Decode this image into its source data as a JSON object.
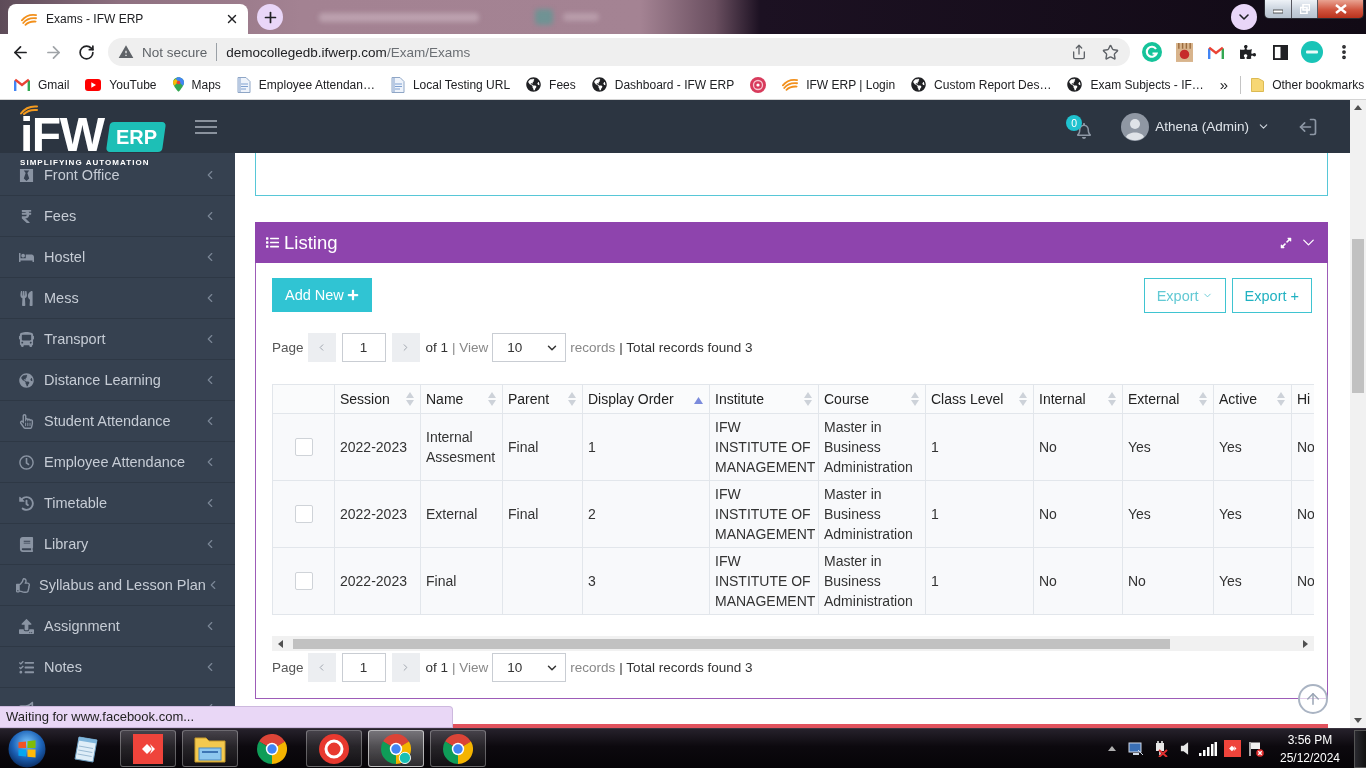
{
  "browser": {
    "tabs": [
      {
        "title": "Exams - IFW ERP",
        "selected": true
      }
    ],
    "address_bar": {
      "security": "Not secure",
      "host": "democollegedb.ifwerp.com",
      "path": "/Exam/Exams"
    },
    "bookmarks": [
      {
        "kind": "link",
        "label": "Gmail"
      },
      {
        "kind": "link",
        "label": "YouTube"
      },
      {
        "kind": "link",
        "label": "Maps"
      },
      {
        "kind": "link",
        "label": "Employee Attendan…"
      },
      {
        "kind": "link",
        "label": "Local Testing URL"
      },
      {
        "kind": "link",
        "label": "Fees"
      },
      {
        "kind": "link",
        "label": "Dashboard - IFW ERP"
      },
      {
        "kind": "icon"
      },
      {
        "kind": "link",
        "label": "IFW ERP | Login"
      },
      {
        "kind": "link",
        "label": "Custom Report Des…"
      },
      {
        "kind": "link",
        "label": "Exam Subjects - IF…"
      }
    ],
    "bookmarks_overflow": "»",
    "other_bookmarks": "Other bookmarks"
  },
  "app": {
    "logo": {
      "wordmark": "iFW",
      "badge": "ERP",
      "tagline": "SIMPLIFYING AUTOMATION"
    },
    "header": {
      "notification_count": "0",
      "user": "Athena (Admin)"
    },
    "sidebar": {
      "items": [
        {
          "label": "Front Office",
          "expanded": false
        },
        {
          "label": "Fees",
          "expanded": false
        },
        {
          "label": "Hostel",
          "expanded": false
        },
        {
          "label": "Mess",
          "expanded": false
        },
        {
          "label": "Transport",
          "expanded": false
        },
        {
          "label": "Distance Learning",
          "expanded": false
        },
        {
          "label": "Student Attendance",
          "expanded": false
        },
        {
          "label": "Employee Attendance",
          "expanded": false
        },
        {
          "label": "Timetable",
          "expanded": false
        },
        {
          "label": "Library",
          "expanded": false
        },
        {
          "label": "Syllabus and Lesson Plan",
          "expanded": false
        },
        {
          "label": "Assignment",
          "expanded": false
        },
        {
          "label": "Notes",
          "expanded": false
        },
        {
          "expanded": false
        }
      ]
    },
    "listing": {
      "title": "Listing",
      "add_button": "Add New",
      "export_buttons": [
        {
          "kind": "dropdown",
          "label": "Export"
        },
        {
          "kind": "plain",
          "label": "Export +"
        }
      ],
      "pagination": [
        {
          "label": "Page",
          "page": "1",
          "total_pages": "of 1",
          "view_label": "| View",
          "page_size": "10",
          "records_label": "records",
          "total": "| Total records found 3"
        },
        {
          "label": "Page",
          "page": "1",
          "total_pages": "of 1",
          "view_label": "| View",
          "page_size": "10",
          "records_label": "records",
          "total": "| Total records found 3"
        }
      ],
      "table": {
        "columns": [
          {
            "label": "Session",
            "sorted": false
          },
          {
            "label": "Name",
            "sorted": false
          },
          {
            "label": "Parent",
            "sorted": false
          },
          {
            "label": "Display Order",
            "sorted": true
          },
          {
            "label": "Institute",
            "sorted": false
          },
          {
            "label": "Course",
            "sorted": false
          },
          {
            "label": "Class Level",
            "sorted": false
          },
          {
            "label": "Internal",
            "sorted": false
          },
          {
            "label": "External",
            "sorted": false
          },
          {
            "label": "Active",
            "sorted": false
          },
          {
            "label": "Hi"
          }
        ],
        "rows": [
          {
            "checked": false,
            "cells": [
              "2022-2023",
              "Internal Assesment",
              "Final",
              "1",
              "IFW INSTITUTE OF MANAGEMENT",
              "Master in Business Administration",
              "1",
              "No",
              "Yes",
              "Yes",
              "No"
            ]
          },
          {
            "checked": false,
            "cells": [
              "2022-2023",
              "External",
              "Final",
              "2",
              "IFW INSTITUTE OF MANAGEMENT",
              "Master in Business Administration",
              "1",
              "No",
              "Yes",
              "Yes",
              "No"
            ]
          },
          {
            "checked": false,
            "cells": [
              "2022-2023",
              "Final",
              null,
              "3",
              "IFW INSTITUTE OF MANAGEMENT",
              "Master in Business Administration",
              "1",
              "No",
              "No",
              "Yes",
              "No"
            ]
          }
        ]
      }
    }
  },
  "status_bubble": "Waiting for www.facebook.com...",
  "taskbar": {
    "apps": [
      {
        "running": false,
        "selected": false
      },
      {
        "running": true,
        "selected": false
      },
      {
        "running": true,
        "selected": false
      },
      {
        "running": false,
        "selected": false
      },
      {
        "running": true,
        "selected": false
      },
      {
        "running": true,
        "selected": true
      },
      {
        "running": true,
        "selected": false
      }
    ],
    "time": "3:56 PM",
    "date": "25/12/2024"
  }
}
